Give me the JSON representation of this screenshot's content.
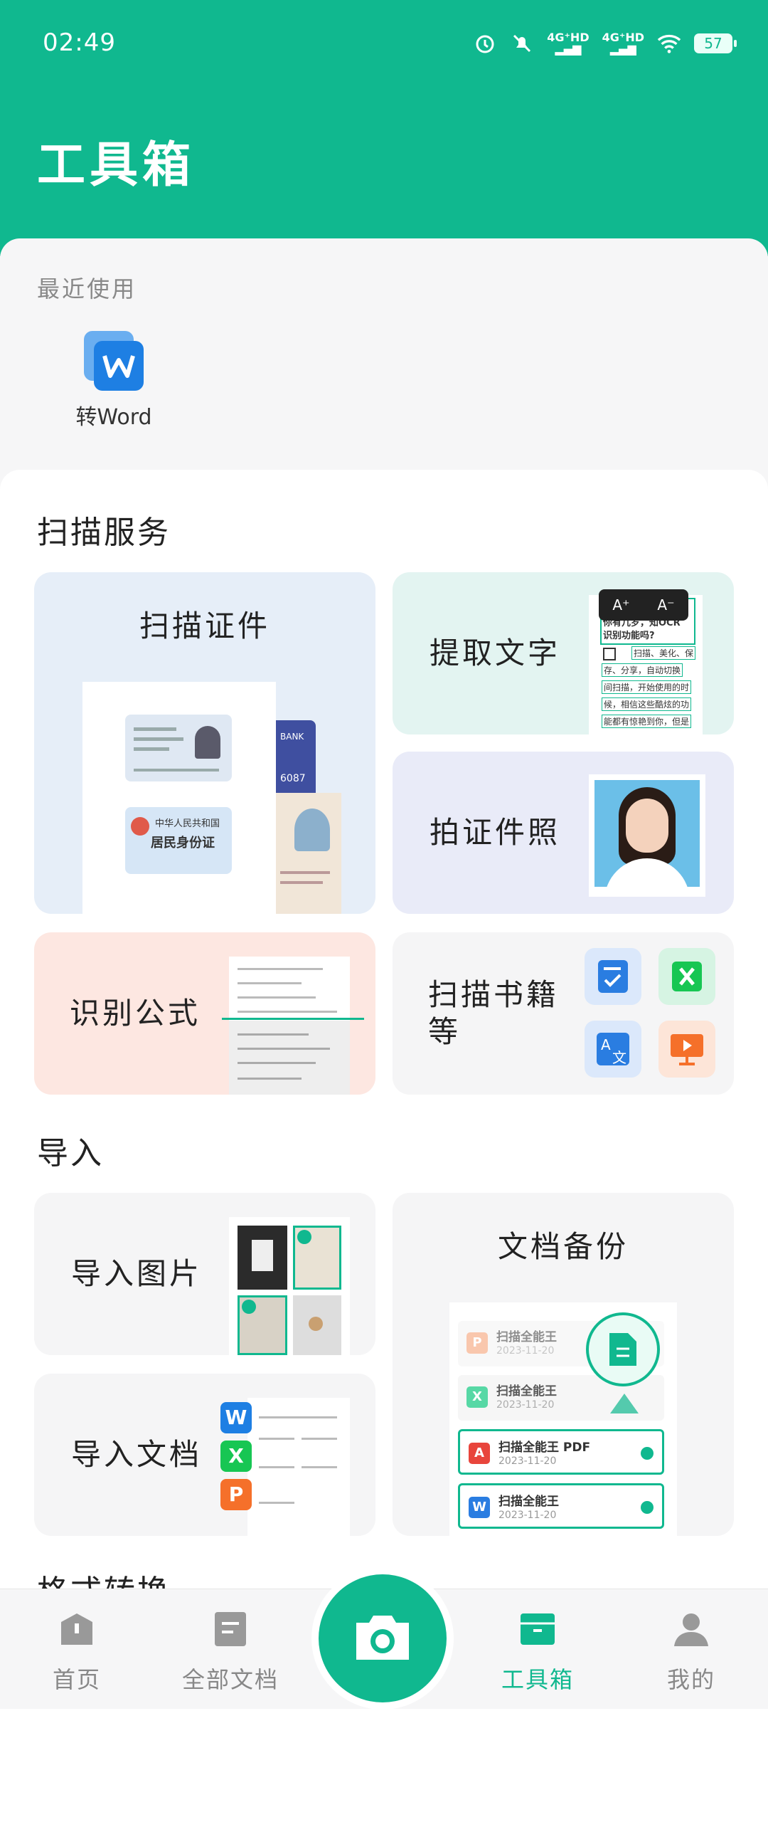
{
  "status": {
    "time": "02:49",
    "net1": "4G⁺HD",
    "net2": "4G⁺HD",
    "battery": "57"
  },
  "header": {
    "title": "工具箱"
  },
  "recent": {
    "title": "最近使用",
    "items": [
      {
        "label": "转Word",
        "icon": "word-icon"
      }
    ]
  },
  "scan": {
    "title": "扫描服务",
    "cards": {
      "id_scan": "扫描证件",
      "extract_text": "提取文字",
      "id_photo": "拍证件照",
      "formula": "识别公式",
      "books": "扫描书籍等"
    },
    "ocr_preview": {
      "line1": "你有几岁，知OCR",
      "line2": "识别功能吗?",
      "line3": "扫描、美化、保",
      "line4": "存、分享，自动切换",
      "line5": "间扫描，开始使用的时",
      "line6": "候，相信这些酷炫的功",
      "line7": "能都有惊艳到你，但是",
      "font_up": "A⁺",
      "font_down": "A⁻"
    },
    "id_preview": {
      "card_title": "中华人民共和国",
      "card_subtitle": "居民身份证",
      "bank": "BANK",
      "bank_num": "6087"
    }
  },
  "import": {
    "title": "导入",
    "image": "导入图片",
    "doc": "导入文档",
    "backup": "文档备份",
    "backup_files": [
      {
        "name": "扫描全能王",
        "date": "2023-11-20",
        "kind": "P",
        "color": "#f59a6b",
        "selected": false
      },
      {
        "name": "扫描全能王",
        "date": "2023-11-20",
        "kind": "X",
        "color": "#2ecf8f",
        "selected": false
      },
      {
        "name": "扫描全能王 PDF",
        "date": "2023-11-20",
        "kind": "A",
        "color": "#e8453c",
        "selected": true
      },
      {
        "name": "扫描全能王",
        "date": "2023-11-20",
        "kind": "W",
        "color": "#2a7de1",
        "selected": true
      }
    ]
  },
  "format": {
    "title": "格式转换"
  },
  "tabs": [
    {
      "label": "首页",
      "icon": "home-icon",
      "active": false
    },
    {
      "label": "全部文档",
      "icon": "documents-icon",
      "active": false
    },
    {
      "label": "工具箱",
      "icon": "toolbox-icon",
      "active": true
    },
    {
      "label": "我的",
      "icon": "profile-icon",
      "active": false
    }
  ],
  "colors": {
    "brand": "#10b88f"
  }
}
